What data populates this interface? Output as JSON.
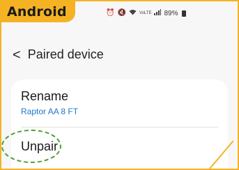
{
  "badge": {
    "text": "Android"
  },
  "status_bar": {
    "battery_text": "89%",
    "icons": [
      "alarm-icon",
      "mute-icon",
      "wifi-icon",
      "volte-icon",
      "signal-icon",
      "battery-icon"
    ]
  },
  "header": {
    "back_glyph": "<",
    "title": "Paired device"
  },
  "settings": {
    "rename": {
      "label": "Rename",
      "value": "Raptor AA 8 FT"
    },
    "unpair": {
      "label": "Unpair"
    }
  },
  "colors": {
    "badge_bg": "#f5b324",
    "frame_border": "#f5b324",
    "link_blue": "#1e76c8",
    "highlight_green": "#4a9f2e"
  }
}
